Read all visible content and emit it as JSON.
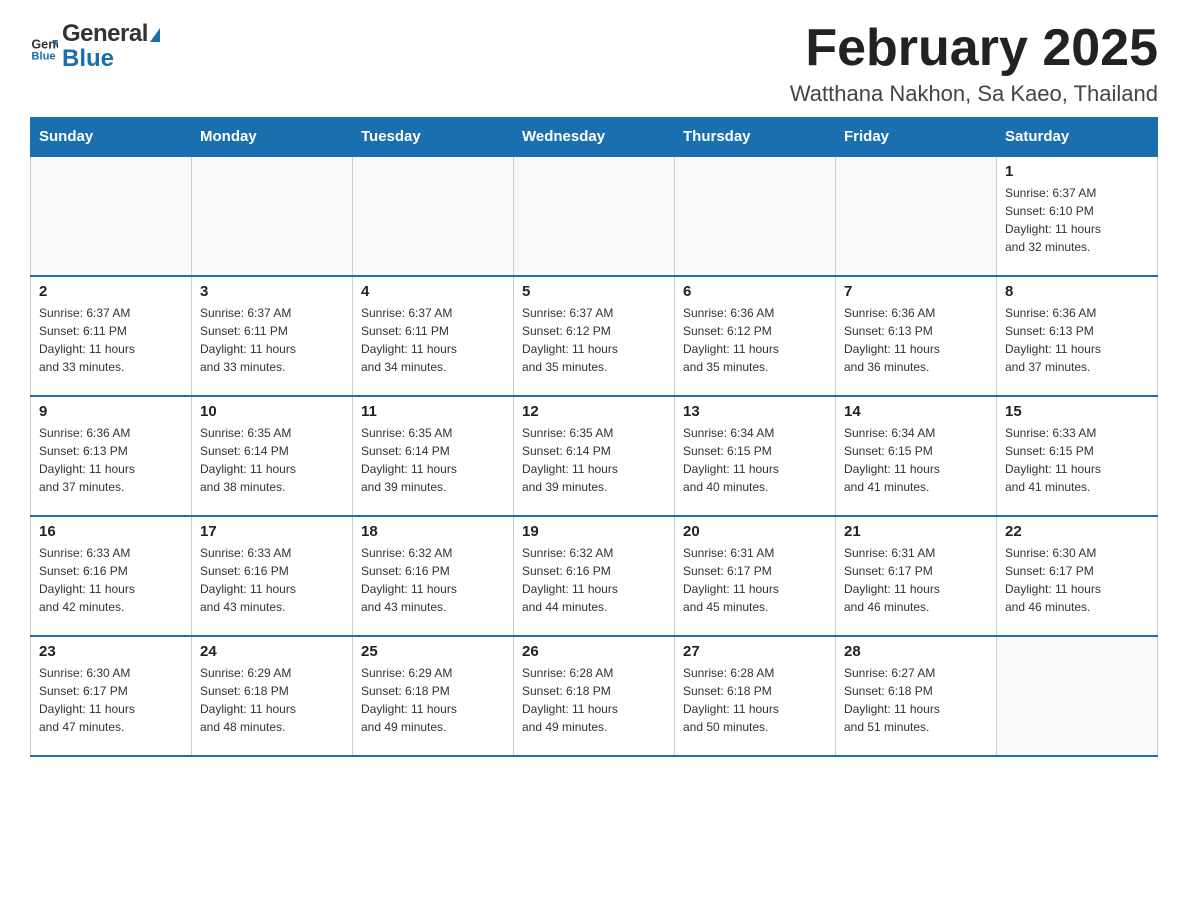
{
  "header": {
    "logo_general": "General",
    "logo_blue": "Blue",
    "month_title": "February 2025",
    "location": "Watthana Nakhon, Sa Kaeo, Thailand"
  },
  "weekdays": [
    "Sunday",
    "Monday",
    "Tuesday",
    "Wednesday",
    "Thursday",
    "Friday",
    "Saturday"
  ],
  "weeks": [
    {
      "days": [
        {
          "num": "",
          "info": ""
        },
        {
          "num": "",
          "info": ""
        },
        {
          "num": "",
          "info": ""
        },
        {
          "num": "",
          "info": ""
        },
        {
          "num": "",
          "info": ""
        },
        {
          "num": "",
          "info": ""
        },
        {
          "num": "1",
          "info": "Sunrise: 6:37 AM\nSunset: 6:10 PM\nDaylight: 11 hours\nand 32 minutes."
        }
      ]
    },
    {
      "days": [
        {
          "num": "2",
          "info": "Sunrise: 6:37 AM\nSunset: 6:11 PM\nDaylight: 11 hours\nand 33 minutes."
        },
        {
          "num": "3",
          "info": "Sunrise: 6:37 AM\nSunset: 6:11 PM\nDaylight: 11 hours\nand 33 minutes."
        },
        {
          "num": "4",
          "info": "Sunrise: 6:37 AM\nSunset: 6:11 PM\nDaylight: 11 hours\nand 34 minutes."
        },
        {
          "num": "5",
          "info": "Sunrise: 6:37 AM\nSunset: 6:12 PM\nDaylight: 11 hours\nand 35 minutes."
        },
        {
          "num": "6",
          "info": "Sunrise: 6:36 AM\nSunset: 6:12 PM\nDaylight: 11 hours\nand 35 minutes."
        },
        {
          "num": "7",
          "info": "Sunrise: 6:36 AM\nSunset: 6:13 PM\nDaylight: 11 hours\nand 36 minutes."
        },
        {
          "num": "8",
          "info": "Sunrise: 6:36 AM\nSunset: 6:13 PM\nDaylight: 11 hours\nand 37 minutes."
        }
      ]
    },
    {
      "days": [
        {
          "num": "9",
          "info": "Sunrise: 6:36 AM\nSunset: 6:13 PM\nDaylight: 11 hours\nand 37 minutes."
        },
        {
          "num": "10",
          "info": "Sunrise: 6:35 AM\nSunset: 6:14 PM\nDaylight: 11 hours\nand 38 minutes."
        },
        {
          "num": "11",
          "info": "Sunrise: 6:35 AM\nSunset: 6:14 PM\nDaylight: 11 hours\nand 39 minutes."
        },
        {
          "num": "12",
          "info": "Sunrise: 6:35 AM\nSunset: 6:14 PM\nDaylight: 11 hours\nand 39 minutes."
        },
        {
          "num": "13",
          "info": "Sunrise: 6:34 AM\nSunset: 6:15 PM\nDaylight: 11 hours\nand 40 minutes."
        },
        {
          "num": "14",
          "info": "Sunrise: 6:34 AM\nSunset: 6:15 PM\nDaylight: 11 hours\nand 41 minutes."
        },
        {
          "num": "15",
          "info": "Sunrise: 6:33 AM\nSunset: 6:15 PM\nDaylight: 11 hours\nand 41 minutes."
        }
      ]
    },
    {
      "days": [
        {
          "num": "16",
          "info": "Sunrise: 6:33 AM\nSunset: 6:16 PM\nDaylight: 11 hours\nand 42 minutes."
        },
        {
          "num": "17",
          "info": "Sunrise: 6:33 AM\nSunset: 6:16 PM\nDaylight: 11 hours\nand 43 minutes."
        },
        {
          "num": "18",
          "info": "Sunrise: 6:32 AM\nSunset: 6:16 PM\nDaylight: 11 hours\nand 43 minutes."
        },
        {
          "num": "19",
          "info": "Sunrise: 6:32 AM\nSunset: 6:16 PM\nDaylight: 11 hours\nand 44 minutes."
        },
        {
          "num": "20",
          "info": "Sunrise: 6:31 AM\nSunset: 6:17 PM\nDaylight: 11 hours\nand 45 minutes."
        },
        {
          "num": "21",
          "info": "Sunrise: 6:31 AM\nSunset: 6:17 PM\nDaylight: 11 hours\nand 46 minutes."
        },
        {
          "num": "22",
          "info": "Sunrise: 6:30 AM\nSunset: 6:17 PM\nDaylight: 11 hours\nand 46 minutes."
        }
      ]
    },
    {
      "days": [
        {
          "num": "23",
          "info": "Sunrise: 6:30 AM\nSunset: 6:17 PM\nDaylight: 11 hours\nand 47 minutes."
        },
        {
          "num": "24",
          "info": "Sunrise: 6:29 AM\nSunset: 6:18 PM\nDaylight: 11 hours\nand 48 minutes."
        },
        {
          "num": "25",
          "info": "Sunrise: 6:29 AM\nSunset: 6:18 PM\nDaylight: 11 hours\nand 49 minutes."
        },
        {
          "num": "26",
          "info": "Sunrise: 6:28 AM\nSunset: 6:18 PM\nDaylight: 11 hours\nand 49 minutes."
        },
        {
          "num": "27",
          "info": "Sunrise: 6:28 AM\nSunset: 6:18 PM\nDaylight: 11 hours\nand 50 minutes."
        },
        {
          "num": "28",
          "info": "Sunrise: 6:27 AM\nSunset: 6:18 PM\nDaylight: 11 hours\nand 51 minutes."
        },
        {
          "num": "",
          "info": ""
        }
      ]
    }
  ]
}
